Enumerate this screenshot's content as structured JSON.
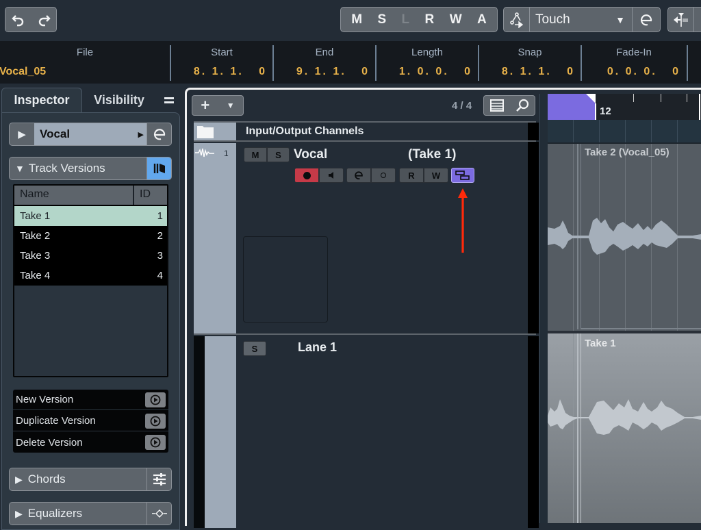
{
  "toolbar": {
    "undo_icon": "undo-icon",
    "redo_icon": "redo-icon",
    "automation_buttons": [
      "M",
      "S",
      "L",
      "R",
      "W",
      "A"
    ],
    "automation_mode": "Touch",
    "colors": {
      "accent_purple": "#7b6be0",
      "record_red": "#c63a48",
      "value_gold": "#e8b24a",
      "selected_row": "#b3d6c9"
    }
  },
  "infoline": {
    "columns": [
      {
        "label": "File",
        "value": "Vocal_05"
      },
      {
        "label": "Start",
        "value": "8. 1. 1.   0"
      },
      {
        "label": "End",
        "value": "9. 1. 1.   0"
      },
      {
        "label": "Length",
        "value": "1. 0. 0.   0"
      },
      {
        "label": "Snap",
        "value": "8. 1. 1.   0"
      },
      {
        "label": "Fade-In",
        "value": "0. 0. 0.   0"
      }
    ]
  },
  "inspector": {
    "tabs": [
      "Inspector",
      "Visibility"
    ],
    "menu_icon": "hamburger-icon",
    "track_name": "Vocal",
    "track_versions_label": "Track Versions",
    "versions_table": {
      "headers": [
        "Name",
        "ID"
      ],
      "rows": [
        {
          "name": "Take 1",
          "id": "1",
          "selected": true
        },
        {
          "name": "Take 2",
          "id": "2",
          "selected": false
        },
        {
          "name": "Take 3",
          "id": "3",
          "selected": false
        },
        {
          "name": "Take 4",
          "id": "4",
          "selected": false
        }
      ]
    },
    "actions": [
      "New Version",
      "Duplicate Version",
      "Delete Version"
    ],
    "sections": [
      "Chords",
      "Equalizers"
    ]
  },
  "project": {
    "add_track_label": "+",
    "track_count": "4 / 4",
    "folder_track": "Input/Output Channels",
    "track": {
      "number": "1",
      "name": "Vocal",
      "version": "(Take 1)",
      "mute": "M",
      "solo": "S",
      "read": "R",
      "write": "W"
    },
    "lane": {
      "name": "Lane 1",
      "solo": "S"
    }
  },
  "timeline": {
    "ruler_label": "12",
    "events": [
      {
        "name": "Take 2 (Vocal_05)"
      },
      {
        "name": "Take 1"
      }
    ]
  }
}
